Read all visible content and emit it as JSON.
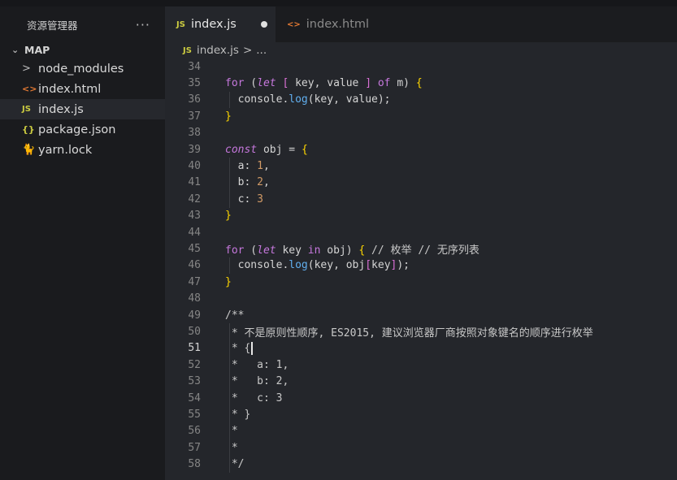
{
  "sidebar": {
    "title": "资源管理器",
    "more": "···",
    "section": "MAP",
    "items": [
      {
        "label": "node_modules",
        "icon": "chevron-right-icon",
        "glyph": ">"
      },
      {
        "label": "index.html",
        "icon": "html-file-icon",
        "glyph": "<>"
      },
      {
        "label": "index.js",
        "icon": "js-file-icon",
        "glyph": "JS"
      },
      {
        "label": "package.json",
        "icon": "json-file-icon",
        "glyph": "{}"
      },
      {
        "label": "yarn.lock",
        "icon": "yarn-icon",
        "glyph": "🐈"
      }
    ]
  },
  "tabs": [
    {
      "label": "index.js",
      "icon": "JS",
      "modified": true
    },
    {
      "label": "index.html",
      "icon": "<>"
    }
  ],
  "breadcrumb": {
    "icon": "JS",
    "file": "index.js",
    "sep": ">",
    "more": "..."
  },
  "code": {
    "lines": [
      {
        "n": "34",
        "text": ""
      },
      {
        "n": "35",
        "text": "for (let [ key, value ] of m) {"
      },
      {
        "n": "36",
        "text": "  console.log(key, value);"
      },
      {
        "n": "37",
        "text": "}"
      },
      {
        "n": "38",
        "text": ""
      },
      {
        "n": "39",
        "text": "const obj = {"
      },
      {
        "n": "40",
        "text": "  a: 1,"
      },
      {
        "n": "41",
        "text": "  b: 2,"
      },
      {
        "n": "42",
        "text": "  c: 3"
      },
      {
        "n": "43",
        "text": "}"
      },
      {
        "n": "44",
        "text": ""
      },
      {
        "n": "45",
        "text": "for (let key in obj) { // 枚举 // 无序列表"
      },
      {
        "n": "46",
        "text": "  console.log(key, obj[key]);"
      },
      {
        "n": "47",
        "text": "}"
      },
      {
        "n": "48",
        "text": ""
      },
      {
        "n": "49",
        "text": "/**"
      },
      {
        "n": "50",
        "text": " * 不是原则性顺序, ES2015, 建议浏览器厂商按照对象键名的顺序进行枚举"
      },
      {
        "n": "51",
        "text": " * {"
      },
      {
        "n": "52",
        "text": " *   a: 1,"
      },
      {
        "n": "53",
        "text": " *   b: 2,"
      },
      {
        "n": "54",
        "text": " *   c: 3"
      },
      {
        "n": "55",
        "text": " * }"
      },
      {
        "n": "56",
        "text": " *"
      },
      {
        "n": "57",
        "text": " *"
      },
      {
        "n": "58",
        "text": " */"
      }
    ],
    "current_line": "51"
  },
  "colors": {
    "background": "#24262b",
    "sidebar": "#1a1b1e",
    "keyword": "#c678dd",
    "function": "#61afef",
    "number": "#d19a66"
  }
}
